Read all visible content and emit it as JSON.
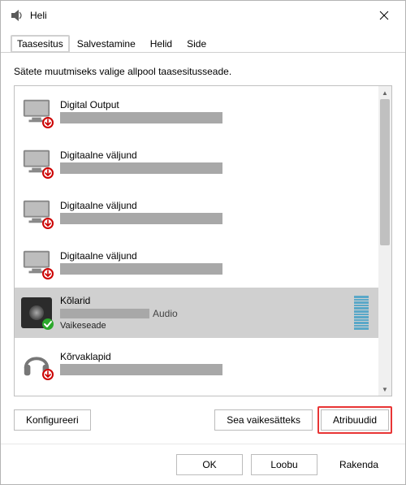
{
  "window": {
    "title": "Heli"
  },
  "tabs": [
    {
      "label": "Taasesitus",
      "active": true,
      "highlight": true
    },
    {
      "label": "Salvestamine",
      "active": false,
      "highlight": false
    },
    {
      "label": "Helid",
      "active": false,
      "highlight": false
    },
    {
      "label": "Side",
      "active": false,
      "highlight": false
    }
  ],
  "instruction": "Sätete muutmiseks valige allpool taasesitusseade.",
  "devices": [
    {
      "name": "Digital Output",
      "kind": "monitor",
      "badge": "down",
      "selected": false
    },
    {
      "name": "Digitaalne väljund",
      "kind": "monitor",
      "badge": "down",
      "selected": false
    },
    {
      "name": "Digitaalne väljund",
      "kind": "monitor",
      "badge": "down",
      "selected": false
    },
    {
      "name": "Digitaalne väljund",
      "kind": "monitor",
      "badge": "down",
      "selected": false
    },
    {
      "name": "Kõlarid",
      "kind": "speakers",
      "badge": "check",
      "selected": true,
      "subSuffix": "Audio",
      "status": "Vaikeseade"
    },
    {
      "name": "Kõrvaklapid",
      "kind": "headphones",
      "badge": "down",
      "selected": false
    }
  ],
  "buttons": {
    "configure": "Konfigureeri",
    "setDefault": "Sea vaikesätteks",
    "properties": "Atribuudid",
    "ok": "OK",
    "cancel": "Loobu",
    "apply": "Rakenda"
  },
  "highlights": {
    "propertiesButton": true
  }
}
